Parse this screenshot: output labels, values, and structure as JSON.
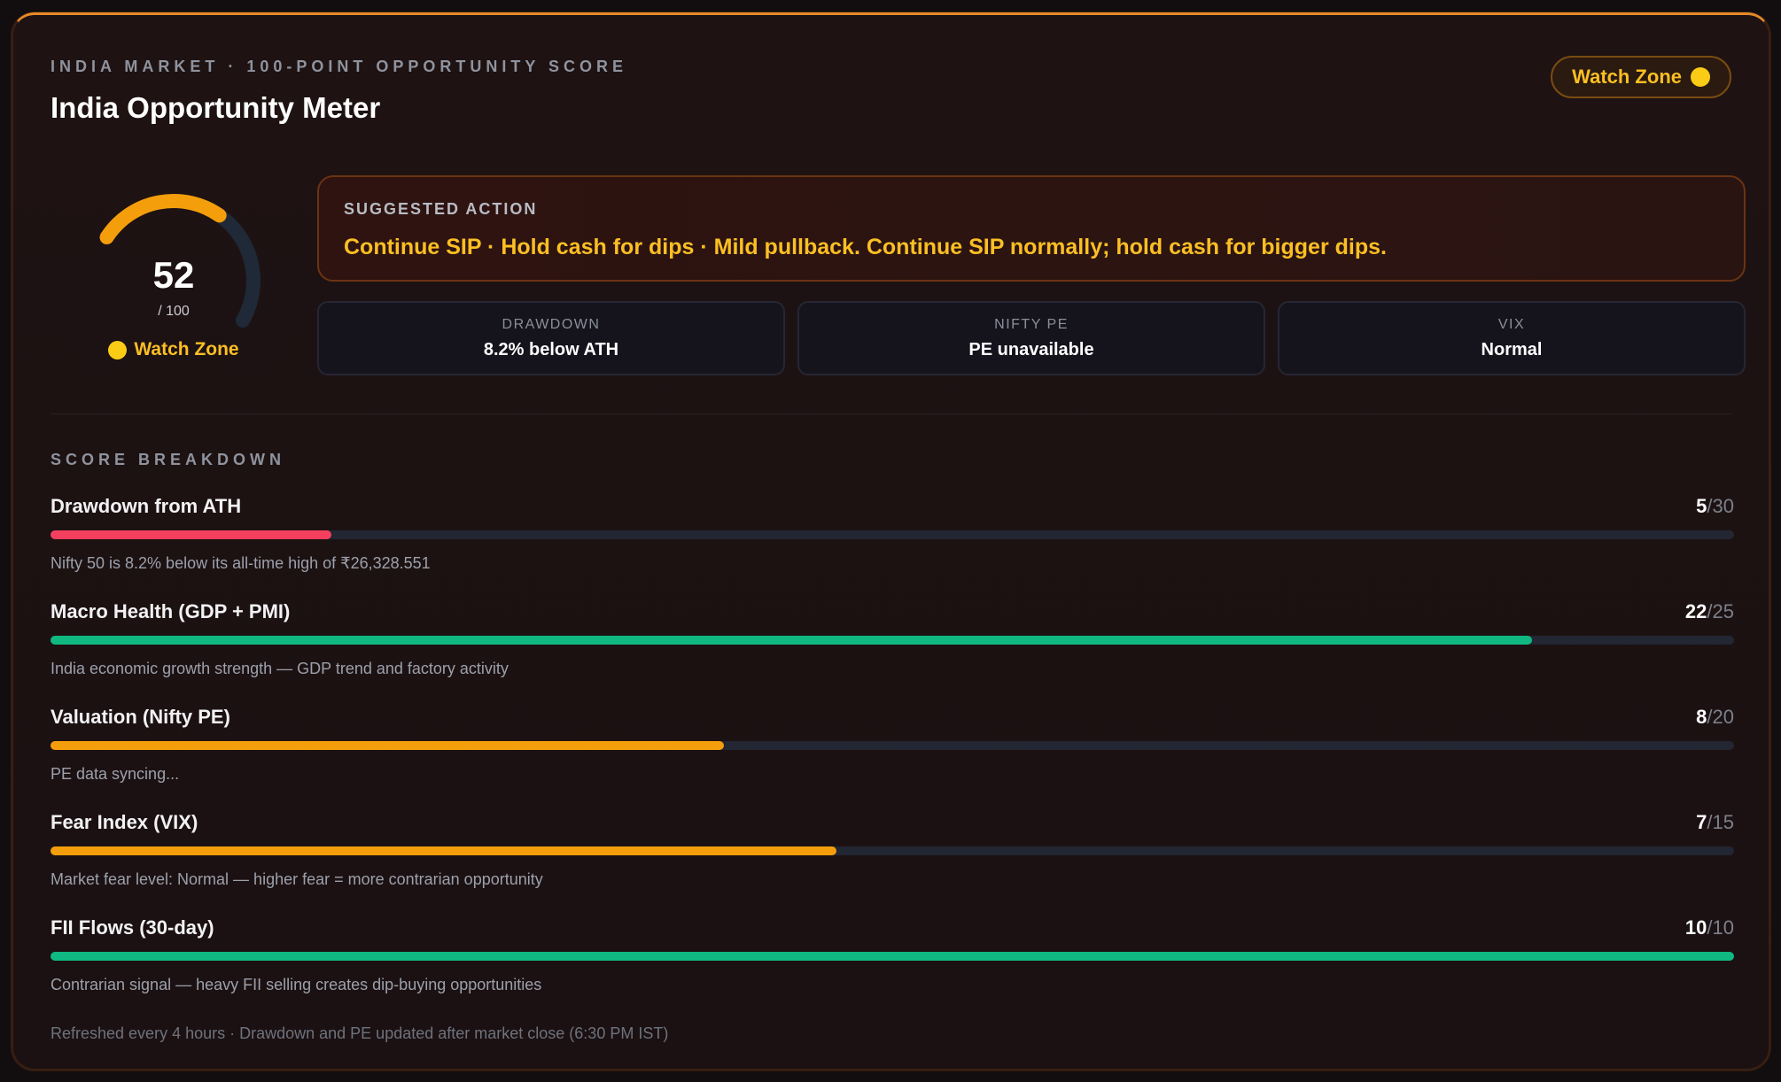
{
  "header": {
    "eyebrow": "INDIA MARKET · 100-POINT OPPORTUNITY SCORE",
    "title": "India Opportunity Meter",
    "zone_badge": "Watch Zone"
  },
  "gauge": {
    "score": 52,
    "max_label": "/ 100",
    "zone_label": "Watch Zone",
    "fraction": 0.52
  },
  "action": {
    "label": "SUGGESTED ACTION",
    "text": "Continue SIP · Hold cash for dips · Mild pullback. Continue SIP normally; hold cash for bigger dips."
  },
  "stats": [
    {
      "label": "DRAWDOWN",
      "value": "8.2% below ATH"
    },
    {
      "label": "NIFTY PE",
      "value": "PE unavailable"
    },
    {
      "label": "VIX",
      "value": "Normal"
    }
  ],
  "breakdown": {
    "label": "SCORE BREAKDOWN",
    "rows": [
      {
        "name": "Drawdown from ATH",
        "score": "5",
        "max": "/30",
        "fraction": 0.1667,
        "color": "#f43f5e",
        "desc": "Nifty 50 is 8.2% below its all-time high of ₹26,328.551"
      },
      {
        "name": "Macro Health (GDP + PMI)",
        "score": "22",
        "max": "/25",
        "fraction": 0.88,
        "color": "#10b981",
        "desc": "India economic growth strength — GDP trend and factory activity"
      },
      {
        "name": "Valuation (Nifty PE)",
        "score": "8",
        "max": "/20",
        "fraction": 0.4,
        "color": "#f59e0b",
        "desc": "PE data syncing..."
      },
      {
        "name": "Fear Index (VIX)",
        "score": "7",
        "max": "/15",
        "fraction": 0.4667,
        "color": "#f59e0b",
        "desc": "Market fear level: Normal — higher fear = more contrarian opportunity"
      },
      {
        "name": "FII Flows (30-day)",
        "score": "10",
        "max": "/10",
        "fraction": 1.0,
        "color": "#10b981",
        "desc": "Contrarian signal — heavy FII selling creates dip-buying opportunities"
      }
    ]
  },
  "footer": "Refreshed every 4 hours · Drawdown and PE updated after market close (6:30 PM IST)",
  "colors": {
    "accent": "#f59e0b",
    "zone": "#fbbf24",
    "gauge_track": "#1f2937"
  }
}
